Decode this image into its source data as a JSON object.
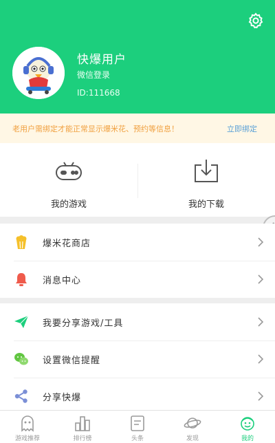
{
  "header": {
    "username": "快爆用户",
    "login_type": "微信登录",
    "user_id": "ID:111668"
  },
  "notice": {
    "text": "老用户需绑定才能正常显示爆米花、预约等信息！",
    "link": "立即绑定"
  },
  "tiles": [
    {
      "label": "我的游戏",
      "icon": "gamepad-icon"
    },
    {
      "label": "我的下载",
      "icon": "download-icon"
    }
  ],
  "menu_group_1": [
    {
      "label": "爆米花商店",
      "icon": "popcorn-icon"
    },
    {
      "label": "消息中心",
      "icon": "bell-icon"
    }
  ],
  "menu_group_2": [
    {
      "label": "我要分享游戏/工具",
      "icon": "paper-plane-icon"
    },
    {
      "label": "设置微信提醒",
      "icon": "wechat-icon"
    },
    {
      "label": "分享快爆",
      "icon": "share-icon"
    }
  ],
  "tabbar": [
    {
      "label": "游戏推荐",
      "icon": "ghost-icon",
      "active": false
    },
    {
      "label": "排行榜",
      "icon": "ranking-icon",
      "active": false
    },
    {
      "label": "头条",
      "icon": "news-icon",
      "active": false
    },
    {
      "label": "发现",
      "icon": "planet-icon",
      "active": false
    },
    {
      "label": "我的",
      "icon": "profile-face-icon",
      "active": true
    }
  ],
  "colors": {
    "accent": "#1ccf7d",
    "notice_bg": "#fff7e5",
    "notice_text": "#f0a040",
    "link": "#5aa0d6",
    "popcorn": "#f5c02a",
    "bell": "#ef5b4c",
    "share": "#7b8fd6"
  }
}
